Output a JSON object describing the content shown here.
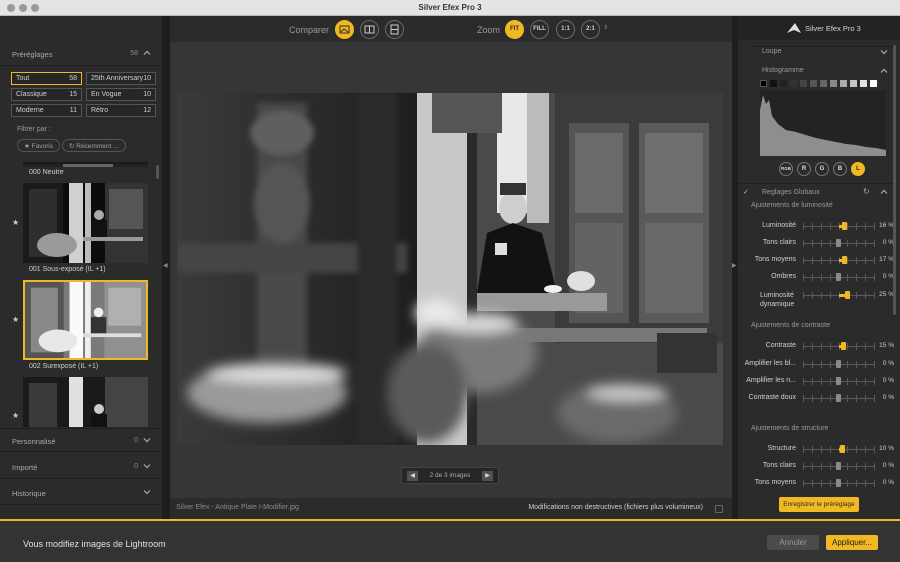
{
  "window": {
    "title": "Silver Efex Pro 3"
  },
  "left": {
    "presets": {
      "label": "Préréglages",
      "count": "58"
    },
    "categories": [
      {
        "label": "Tout",
        "count": "58"
      },
      {
        "label": "25th Anniversary",
        "count": "10"
      },
      {
        "label": "Classique",
        "count": "15"
      },
      {
        "label": "En Vogue",
        "count": "10"
      },
      {
        "label": "Moderne",
        "count": "11"
      },
      {
        "label": "Rétro",
        "count": "12"
      }
    ],
    "filter_label": "Filtrer par :",
    "filters": [
      "★ Favoris",
      "↻ Récemment ..."
    ],
    "thumbs": [
      "000 Neutre",
      "001 Sous-exposé (IL +1)",
      "002 Surexposé (IL +1)"
    ],
    "sections": [
      {
        "label": "Personnalisé",
        "count": "0"
      },
      {
        "label": "Importé",
        "count": "0"
      },
      {
        "label": "Historique",
        "count": ""
      }
    ]
  },
  "toolbar": {
    "compare_label": "Comparer",
    "zoom_label": "Zoom",
    "zoom_options": [
      "FIT",
      "FILL",
      "1:1",
      "2:1"
    ]
  },
  "pager": {
    "text": "2 de 3 images"
  },
  "status": {
    "filename": "Silver Efex - Antique Plate I-Modifier.jpg",
    "nondestructive": "Modifications non destructives (fichiers plus volumineux)"
  },
  "right": {
    "app_name": "Silver Efex Pro 3",
    "loupe": "Loupe",
    "histogram": "Histogramme",
    "channels": [
      "RGB",
      "R",
      "G",
      "B",
      "L"
    ],
    "global": "Reglages Globaux",
    "lum_title": "Ajustements de luminosité",
    "lum_sliders": [
      {
        "label": "Luminosité",
        "value": "16 %",
        "pct": 16
      },
      {
        "label": "Tons clairs",
        "value": "0 %",
        "pct": 0
      },
      {
        "label": "Tons moyens",
        "value": "17 %",
        "pct": 17
      },
      {
        "label": "Ombres",
        "value": "0 %",
        "pct": 0
      },
      {
        "label": "Luminosité dynamique",
        "value": "25 %",
        "pct": 25
      }
    ],
    "con_title": "Ajustements de contraste",
    "con_sliders": [
      {
        "label": "Contraste",
        "value": "15 %",
        "pct": 15
      },
      {
        "label": "Amplifier les bl...",
        "value": "0 %",
        "pct": 0
      },
      {
        "label": "Amplifier les n...",
        "value": "0 %",
        "pct": 0
      },
      {
        "label": "Contraste doux",
        "value": "0 %",
        "pct": 0
      }
    ],
    "str_title": "Ajustements de structure",
    "str_sliders": [
      {
        "label": "Structure",
        "value": "10 %",
        "pct": 10
      },
      {
        "label": "Tons clairs",
        "value": "0 %",
        "pct": 0
      },
      {
        "label": "Tons moyens",
        "value": "0 %",
        "pct": 0
      }
    ],
    "save_preset": "Enregistrer le préréglage"
  },
  "footer": {
    "message": "Vous modifiez images de Lightroom",
    "cancel": "Annuler",
    "apply": "Appliquer..."
  },
  "colors": {
    "accent": "#f0b823",
    "panel": "#2b2b2b",
    "canvas": "#363636"
  }
}
